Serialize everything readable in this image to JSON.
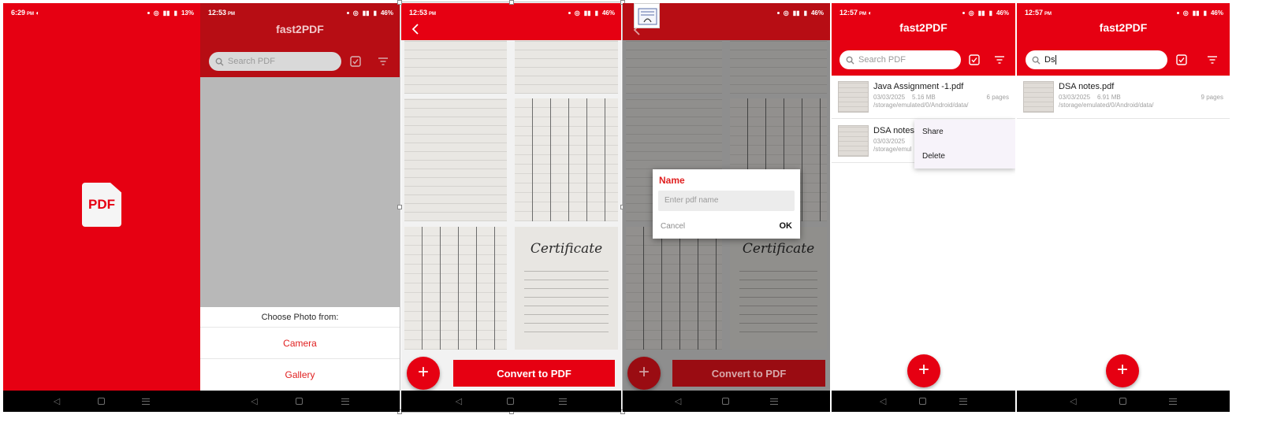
{
  "colors": {
    "primary": "#e60012",
    "dark_primary": "#b70d14",
    "scrim": "#b8b8b8"
  },
  "screen1": {
    "status": {
      "time": "6:29",
      "ampm": "PM",
      "battery": "13%"
    },
    "logo_text": "PDF"
  },
  "screen2": {
    "status": {
      "time": "12:53",
      "ampm": "PM",
      "battery": "46%"
    },
    "title": "fast2PDF",
    "search_placeholder": "Search PDF",
    "sheet": {
      "title": "Choose Photo from:",
      "options": [
        "Camera",
        "Gallery"
      ]
    }
  },
  "screen3": {
    "status": {
      "time": "12:53",
      "ampm": "PM",
      "battery": "46%"
    },
    "fab_label": "+",
    "convert_label": "Convert to PDF",
    "certificate_title": "Certificate"
  },
  "screen4": {
    "status": {
      "battery": "46%"
    },
    "dialog": {
      "title": "Name",
      "placeholder": "Enter pdf name",
      "cancel": "Cancel",
      "ok": "OK"
    },
    "fab_label": "+",
    "convert_label": "Convert to PDF",
    "certificate_title": "Certificate"
  },
  "screen5": {
    "status": {
      "time": "12:57",
      "ampm": "PM",
      "battery": "46%"
    },
    "title": "fast2PDF",
    "search_placeholder": "Search PDF",
    "files": [
      {
        "name": "Java Assignment -1.pdf",
        "date": "03/03/2025",
        "size": "5.16 MB",
        "path": "/storage/emulated/0/Android/data/",
        "pages": "6 pages"
      },
      {
        "name": "DSA notes.p",
        "date": "03/03/2025",
        "path": "/storage/emul"
      }
    ],
    "menu": [
      "Share",
      "Delete"
    ],
    "fab_label": "+"
  },
  "screen6": {
    "status": {
      "time": "12:57",
      "ampm": "PM",
      "battery": "46%"
    },
    "title": "fast2PDF",
    "search_value": "Ds",
    "file": {
      "name": "DSA notes.pdf",
      "date": "03/03/2025",
      "size": "6.91 MB",
      "path": "/storage/emulated/0/Android/data/",
      "pages": "9 pages"
    },
    "fab_label": "+"
  }
}
